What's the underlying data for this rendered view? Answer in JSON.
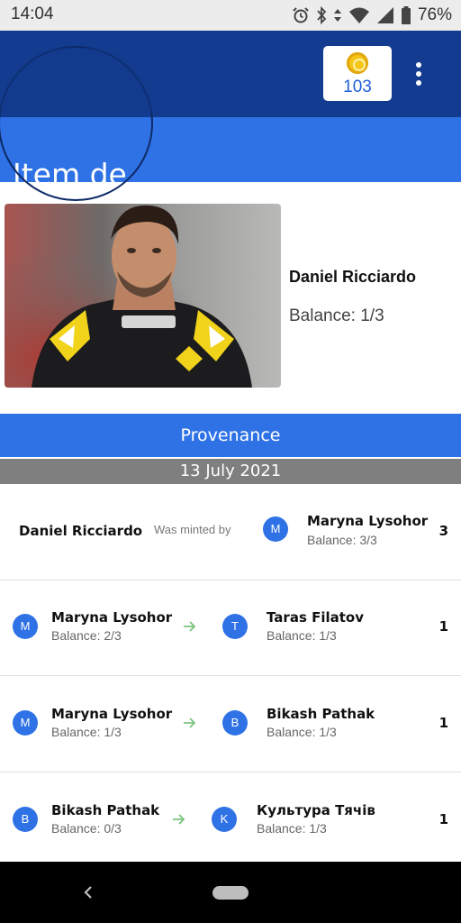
{
  "status_bar": {
    "time": "14:04",
    "battery_percent": "76%",
    "icons": [
      "alarm-icon",
      "bluetooth-icon",
      "data-icon",
      "wifi-icon",
      "cellular-icon",
      "battery-icon"
    ]
  },
  "header": {
    "title": "Item de",
    "coin_count": "103",
    "colors": {
      "top": "#133c91",
      "band": "#2f72e6"
    }
  },
  "item": {
    "name": "Daniel Ricciardo",
    "balance_label": "Balance:  1/3"
  },
  "provenance": {
    "title": "Provenance",
    "date": "13 July 2021",
    "mint_row": {
      "origin_name": "Daniel Ricciardo",
      "action": "Was minted by",
      "to_initial": "M",
      "to_name": "Maryna Lysohor",
      "to_balance": "Balance: 3/3",
      "quantity": "3"
    },
    "transfers": [
      {
        "from_initial": "M",
        "from_name": "Maryna Lysohor",
        "from_balance": "Balance: 2/3",
        "to_initial": "T",
        "to_name": "Taras Filatov",
        "to_balance": "Balance: 1/3",
        "quantity": "1"
      },
      {
        "from_initial": "M",
        "from_name": "Maryna Lysohor",
        "from_balance": "Balance: 1/3",
        "to_initial": "B",
        "to_name": "Bikash Pathak",
        "to_balance": "Balance: 1/3",
        "quantity": "1"
      },
      {
        "from_initial": "B",
        "from_name": "Bikash Pathak",
        "from_balance": "Balance: 0/3",
        "to_initial": "K",
        "to_name": "Культура Тячів",
        "to_balance": "Balance: 1/3",
        "quantity": "1"
      }
    ]
  }
}
